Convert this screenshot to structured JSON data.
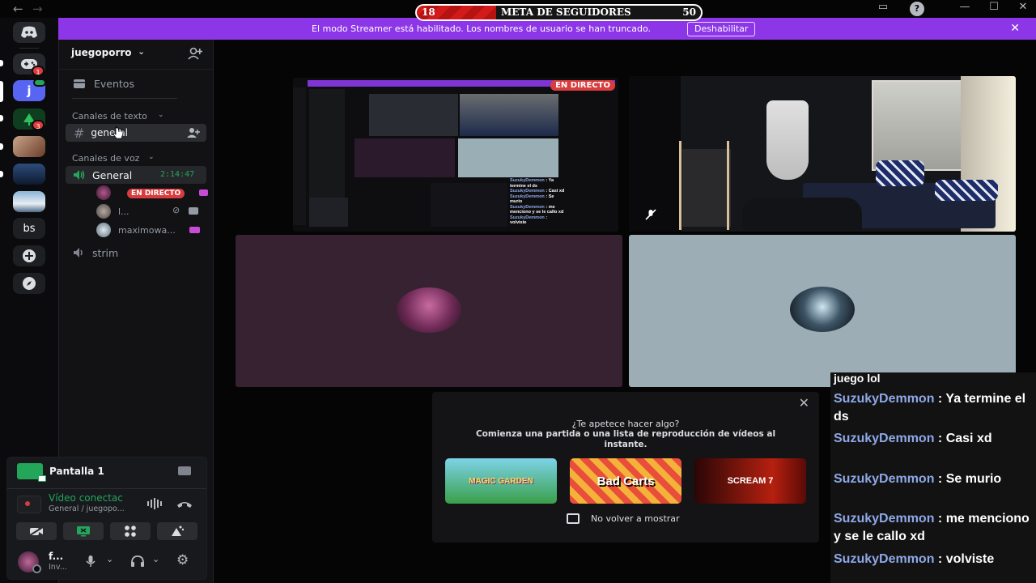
{
  "goal": {
    "start": "18",
    "title": "META DE SEGUIDORES",
    "end": "50",
    "progress_percent": 28
  },
  "banner": {
    "text": "El modo Streamer está habilitado. Los nombres de usuario se han truncado.",
    "button": "Deshabilitar"
  },
  "rail": {
    "items": [
      {
        "label": "",
        "badge": ""
      },
      {
        "label": "",
        "badge": "1"
      },
      {
        "label": "j",
        "badge": ""
      },
      {
        "label": "",
        "badge": "3"
      },
      {
        "label": "",
        "badge": ""
      },
      {
        "label": "",
        "badge": ""
      },
      {
        "label": "",
        "badge": ""
      },
      {
        "label": "bs",
        "badge": ""
      }
    ]
  },
  "sidebar": {
    "server_name": "juegoporro",
    "events_label": "Eventos",
    "text_category": "Canales de texto",
    "text_channel": "general",
    "voice_category": "Canales de voz",
    "voice_channel": "General",
    "voice_timer": "2:14:47",
    "live_label": "EN DIRECTO",
    "voice_users": [
      "",
      "l...",
      "maximowa..."
    ],
    "other_voice_channel": "strim"
  },
  "voice_panel": {
    "screen_label": "Pantalla 1",
    "status": "Vídeo conectac",
    "location": "General / juegopo..."
  },
  "user_panel": {
    "name": "f...",
    "status": "Inv..."
  },
  "stream_preview": {
    "live_label": "EN DIRECTO",
    "chat_names": [
      "SuzukyDemmon",
      "SuzukyDemmon",
      "SuzukyDemmon",
      "SuzukyDemmon",
      "SuzukyDemmon"
    ],
    "chat_msgs": [
      ": Ya termine el ds",
      ": Casi xd",
      ": Se murio",
      ": me menciono y se le callo xd",
      ": volviste"
    ]
  },
  "chat": {
    "partial_top": "juego lol",
    "messages": [
      {
        "user": "SuzukyDemmon",
        "text": ": Ya termine el ds"
      },
      {
        "user": "SuzukyDemmon",
        "text": ": Casi xd"
      },
      {
        "user": "SuzukyDemmon",
        "text": ": Se murio"
      },
      {
        "user": "SuzukyDemmon",
        "text": ": me menciono y se le callo xd"
      },
      {
        "user": "SuzukyDemmon",
        "text": ": volviste"
      }
    ]
  },
  "activity": {
    "title": "¿Te apetece hacer algo?",
    "subtitle": "Comienza una partida o una lista de reproducción de vídeos al instante.",
    "games": [
      "MAGIC GARDEN",
      "Bad Carts",
      "SCREAM 7"
    ],
    "dont_show": "No volver a mostrar"
  },
  "colors": {
    "banner": "#8d36e8",
    "live": "#d83c3e",
    "chat_user": "#8fa8e8",
    "voice_green": "#23a55a"
  }
}
